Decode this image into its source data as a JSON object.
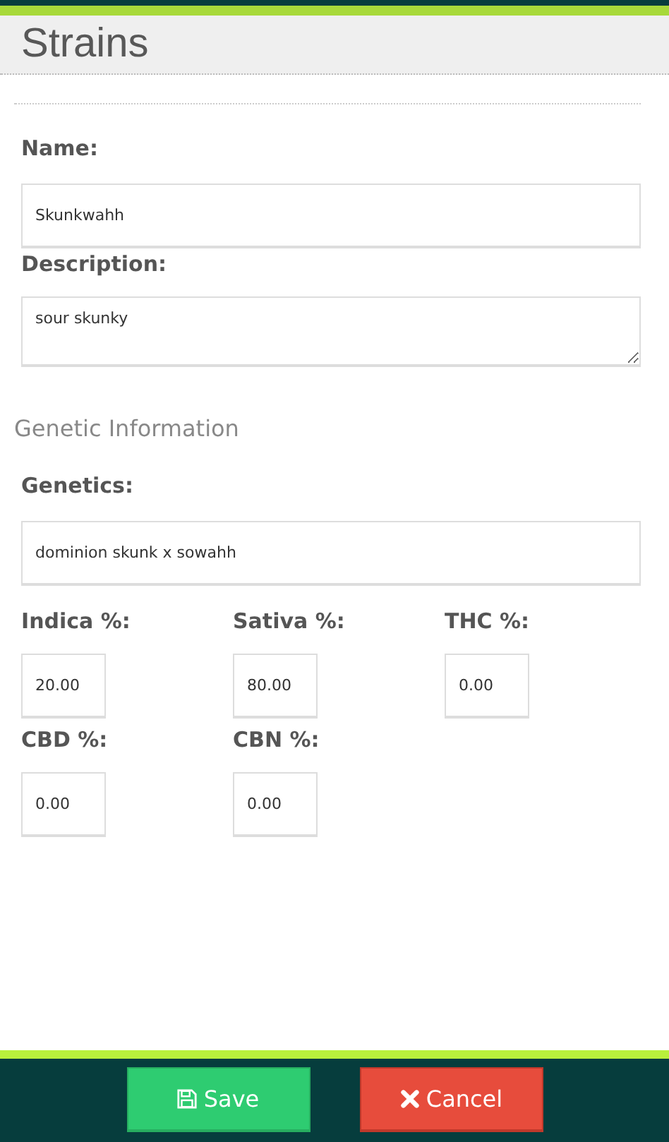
{
  "page_title": "Strains",
  "fields": [
    {
      "label": "Name:",
      "value": "Skunkwahh",
      "kind": "text"
    },
    {
      "label": "Description:",
      "value": "sour skunky",
      "kind": "textarea"
    }
  ],
  "section_title": "Genetic Information",
  "genetics": {
    "label": "Genetics:",
    "value": "dominion skunk x sowahh"
  },
  "measures": [
    {
      "label": "Indica %:",
      "value": "20.00"
    },
    {
      "label": "Sativa %:",
      "value": "80.00"
    },
    {
      "label": "THC %:",
      "value": "0.00"
    },
    {
      "label": "CBD %:",
      "value": "0.00"
    },
    {
      "label": "CBN %:",
      "value": "0.00"
    }
  ],
  "buttons": [
    {
      "label": "Save",
      "kind": "save"
    },
    {
      "label": "Cancel",
      "kind": "cancel"
    }
  ]
}
